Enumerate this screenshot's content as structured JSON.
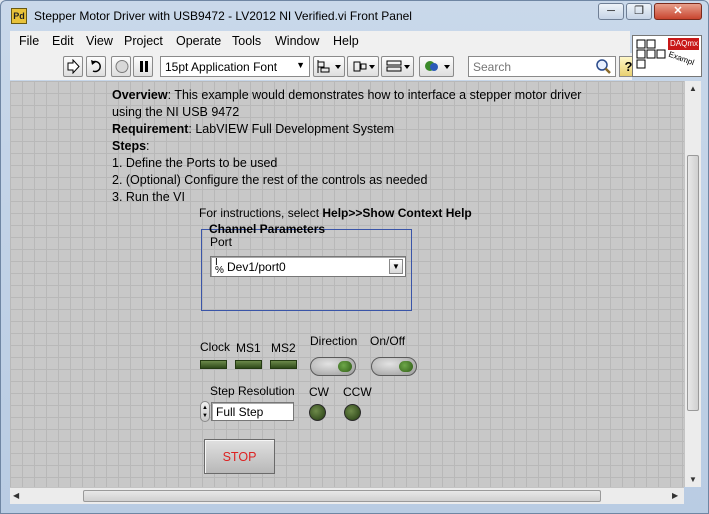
{
  "window": {
    "title": "Stepper Motor Driver with USB9472 - LV2012 NI Verified.vi Front Panel",
    "app_icon_label": "Pd"
  },
  "menu": [
    "File",
    "Edit",
    "View",
    "Project",
    "Operate",
    "Tools",
    "Window",
    "Help"
  ],
  "toolbar": {
    "font_select": "15pt Application Font",
    "search_placeholder": "Search",
    "help_label": "?"
  },
  "logo": {
    "text_top": "DAQmx",
    "text_bottom": "Exampl"
  },
  "description": {
    "overview_label": "Overview",
    "overview_text": ": This example would demonstrates how to interface a stepper motor driver",
    "overview_cont": "using the NI USB 9472",
    "requirement_label": "Requirement",
    "requirement_text": ": LabVIEW Full Development System",
    "steps_label": "Steps",
    "steps_colon": ":",
    "step1": "1. Define the Ports to be used",
    "step2": "2. (Optional) Configure the rest of the controls as needed",
    "step3": "3. Run the VI"
  },
  "instructions": {
    "prefix": "For instructions, select ",
    "bold": "Help>>Show Context Help"
  },
  "cluster": {
    "title": "Channel Parameters",
    "port_label": "Port",
    "port_value": "Dev1/port0",
    "io_glyph_top": "I",
    "io_glyph_bottom": "%"
  },
  "indicators": {
    "clock": "Clock",
    "ms1": "MS1",
    "ms2": "MS2",
    "direction": "Direction",
    "onoff": "On/Off",
    "step_resolution": "Step Resolution",
    "step_resolution_value": "Full Step",
    "cw": "CW",
    "ccw": "CCW"
  },
  "stop_label": "STOP",
  "colors": {
    "panel_bg": "#c8c8c8",
    "cluster_border": "#3a55a8",
    "led_on": "#6ea84a",
    "stop_text": "#dd2222"
  }
}
